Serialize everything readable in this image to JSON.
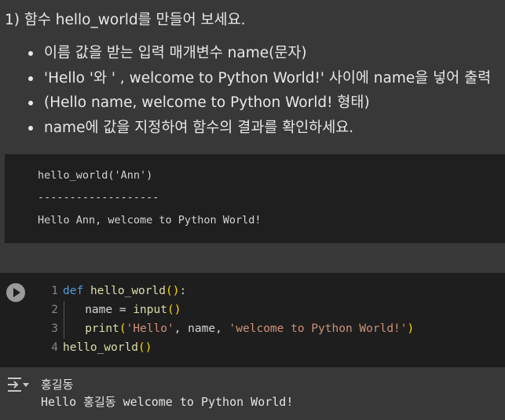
{
  "markdown": {
    "title": "1) 함수 hello_world를 만들어 보세요.",
    "bullets": [
      "이름 값을 받는 입력 매개변수 name(문자)",
      "'Hello '와 ' , welcome to Python World!' 사이에 name을 넣어 출력",
      "(Hello name, welcome to Python World! 형태)",
      "name에 값을 지정하여 함수의 결과를 확인하세요."
    ]
  },
  "sample_output": {
    "lines": [
      "hello_world('Ann')",
      "-------------------",
      "Hello Ann, welcome to Python World!"
    ]
  },
  "code_cell": {
    "line_numbers": [
      "1",
      "2",
      "3",
      "4"
    ],
    "tokens": {
      "l1_kw": "def",
      "l1_fn": "hello_world",
      "l1_paren": "()",
      "l1_colon": ":",
      "l2_var": "name = ",
      "l2_fn": "input",
      "l2_paren": "()",
      "l3_fn": "print",
      "l3_open": "(",
      "l3_str1": "'Hello'",
      "l3_mid": ", name, ",
      "l3_str2": "'welcome to Python World!'",
      "l3_close": ")",
      "l4_fn": "hello_world",
      "l4_paren": "()"
    }
  },
  "output": {
    "icon": "output-toggle-icon",
    "input_value": "홍길동",
    "printed": "Hello 홍길동 welcome to Python World!"
  }
}
